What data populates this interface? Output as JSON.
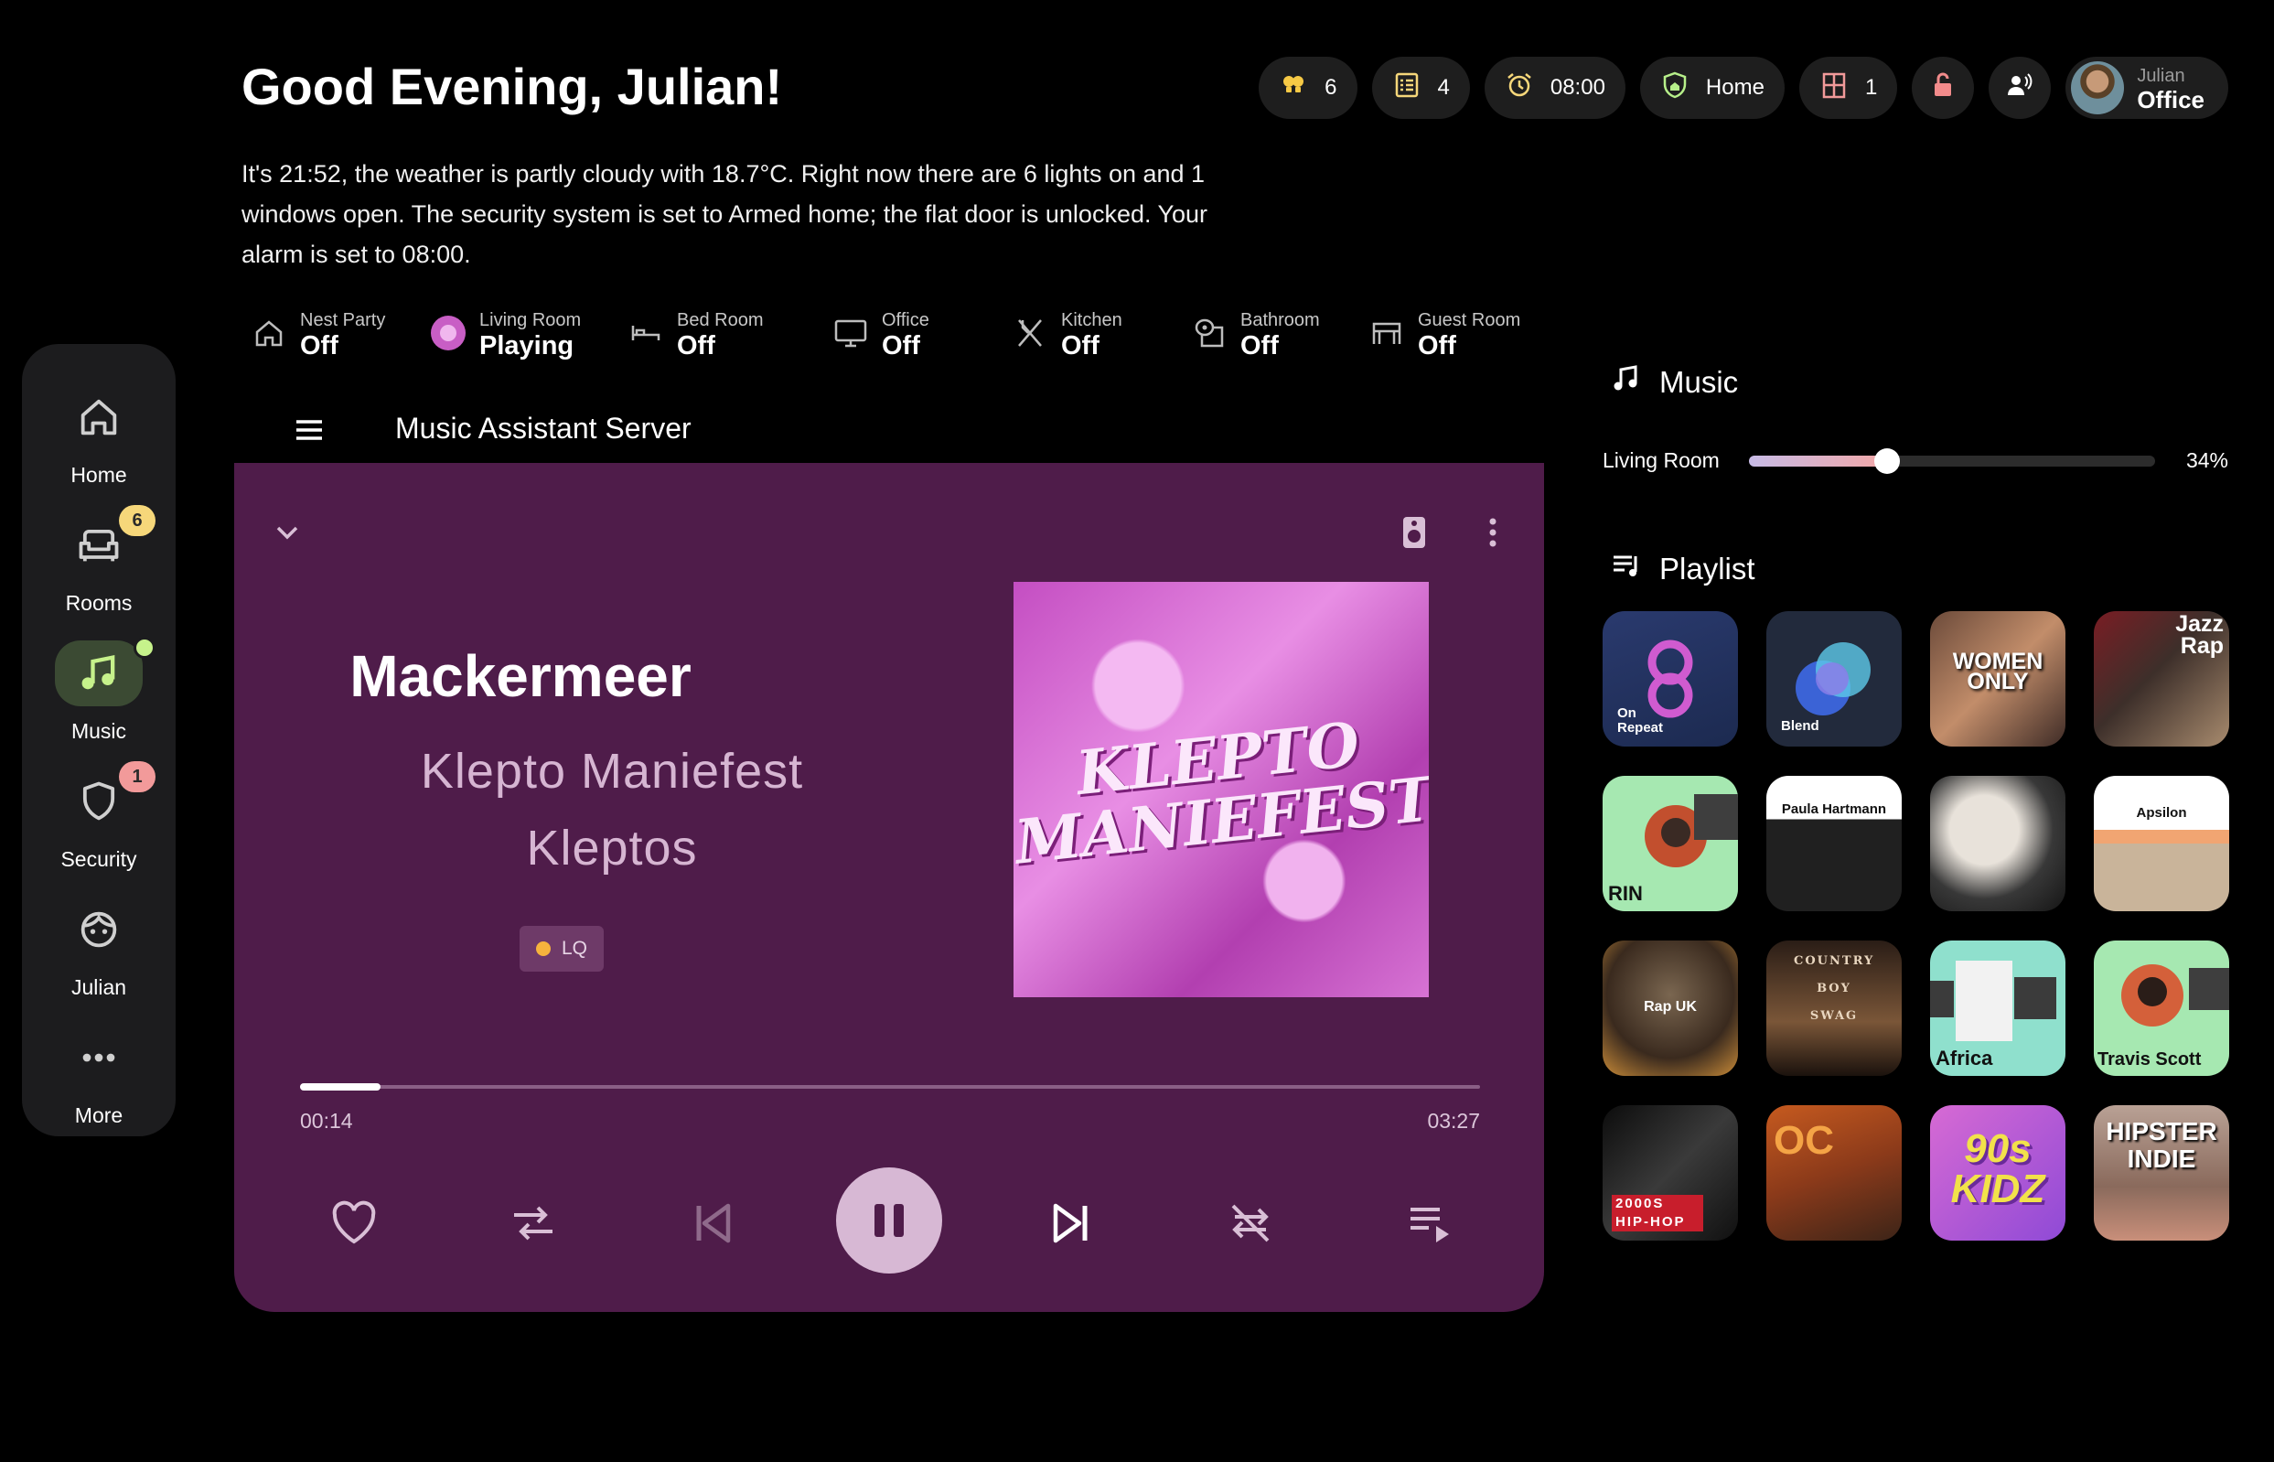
{
  "header": {
    "greeting": "Good Evening, Julian!",
    "summary": "It's 21:52, the weather is partly cloudy with 18.7°C. Right now there are 6 lights on and 1 windows open. The security system is set to Armed home; the flat door is unlocked. Your alarm is set to 08:00."
  },
  "chips": {
    "lights": "6",
    "tasks": "4",
    "alarm": "08:00",
    "security": "Home",
    "windows": "1",
    "user_name": "Julian",
    "user_room": "Office"
  },
  "sidebar": {
    "items": [
      {
        "label": "Home"
      },
      {
        "label": "Rooms",
        "badge": "6"
      },
      {
        "label": "Music"
      },
      {
        "label": "Security",
        "badge": "1"
      },
      {
        "label": "Julian"
      },
      {
        "label": "More"
      }
    ]
  },
  "rooms": [
    {
      "name": "Nest Party",
      "state": "Off"
    },
    {
      "name": "Living Room",
      "state": "Playing"
    },
    {
      "name": "Bed Room",
      "state": "Off"
    },
    {
      "name": "Office",
      "state": "Off"
    },
    {
      "name": "Kitchen",
      "state": "Off"
    },
    {
      "name": "Bathroom",
      "state": "Off"
    },
    {
      "name": "Guest Room",
      "state": "Off"
    }
  ],
  "player": {
    "server_title": "Music Assistant Server",
    "title": "Mackermeer",
    "album": "Klepto Maniefest",
    "artist": "Kleptos",
    "quality": "LQ",
    "cover_text": "KLEPTO MANIEFEST",
    "time_current": "00:14",
    "time_total": "03:27",
    "progress": 0.068
  },
  "music_panel": {
    "heading": "Music",
    "volume_room": "Living Room",
    "volume_pct": "34%",
    "volume": 0.34,
    "playlist_heading": "Playlist",
    "playlists": [
      {
        "text": "On Repeat"
      },
      {
        "text": "Blend"
      },
      {
        "text": "WOMEN ONLY"
      },
      {
        "text": "Jazz Rap"
      },
      {
        "text": "RIN"
      },
      {
        "text": "Paula Hartmann"
      },
      {
        "text": ""
      },
      {
        "text": "Apsilon"
      },
      {
        "text": "Rap UK"
      },
      {
        "text": "COUNTRY BOY SWAG"
      },
      {
        "text": "Africa"
      },
      {
        "text": "Travis Scott"
      },
      {
        "text": "2000S HIP-HOP"
      },
      {
        "text": "OC"
      },
      {
        "text": "90s KIDZ"
      },
      {
        "text": "HIPSTER INDIE"
      }
    ]
  },
  "colors": {
    "player_bg": "#4f1c4a",
    "accent_green": "#c6f28b",
    "badge_yellow": "#f6d77a",
    "badge_red": "#f29a9a"
  }
}
